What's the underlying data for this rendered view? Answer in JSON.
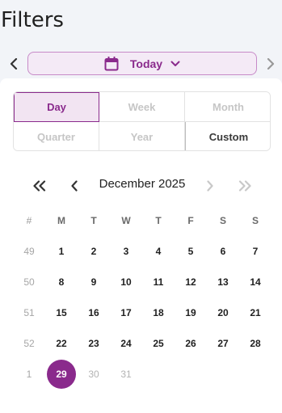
{
  "title": "Filters",
  "icons": {
    "prev": "chevron-left-icon",
    "next": "chevron-right-icon",
    "calendar": "calendar-icon",
    "dropdown": "chevron-down-icon",
    "prev_year": "double-chevron-left-icon",
    "next_year": "double-chevron-right-icon"
  },
  "today_button": {
    "label": "Today"
  },
  "period_tabs": {
    "day": "Day",
    "week": "Week",
    "month": "Month",
    "quarter": "Quarter",
    "year": "Year",
    "custom": "Custom",
    "selected": "Day"
  },
  "calendar": {
    "month_label": "December 2025",
    "headers": [
      "#",
      "M",
      "T",
      "W",
      "T",
      "F",
      "S",
      "S"
    ],
    "weeks": [
      {
        "week": "49",
        "days": [
          "1",
          "2",
          "3",
          "4",
          "5",
          "6",
          "7"
        ]
      },
      {
        "week": "50",
        "days": [
          "8",
          "9",
          "10",
          "11",
          "12",
          "13",
          "14"
        ]
      },
      {
        "week": "51",
        "days": [
          "15",
          "16",
          "17",
          "18",
          "19",
          "20",
          "21"
        ]
      },
      {
        "week": "52",
        "days": [
          "22",
          "23",
          "24",
          "25",
          "26",
          "27",
          "28"
        ]
      },
      {
        "week": "1",
        "days": [
          "29",
          "30",
          "31"
        ]
      }
    ],
    "selected_day": "29",
    "muted_days": [
      "30",
      "31"
    ]
  },
  "colors": {
    "accent": "#8a2a8c",
    "accent_bg": "#f2e4f2",
    "page_bg": "#f2f4f8"
  }
}
